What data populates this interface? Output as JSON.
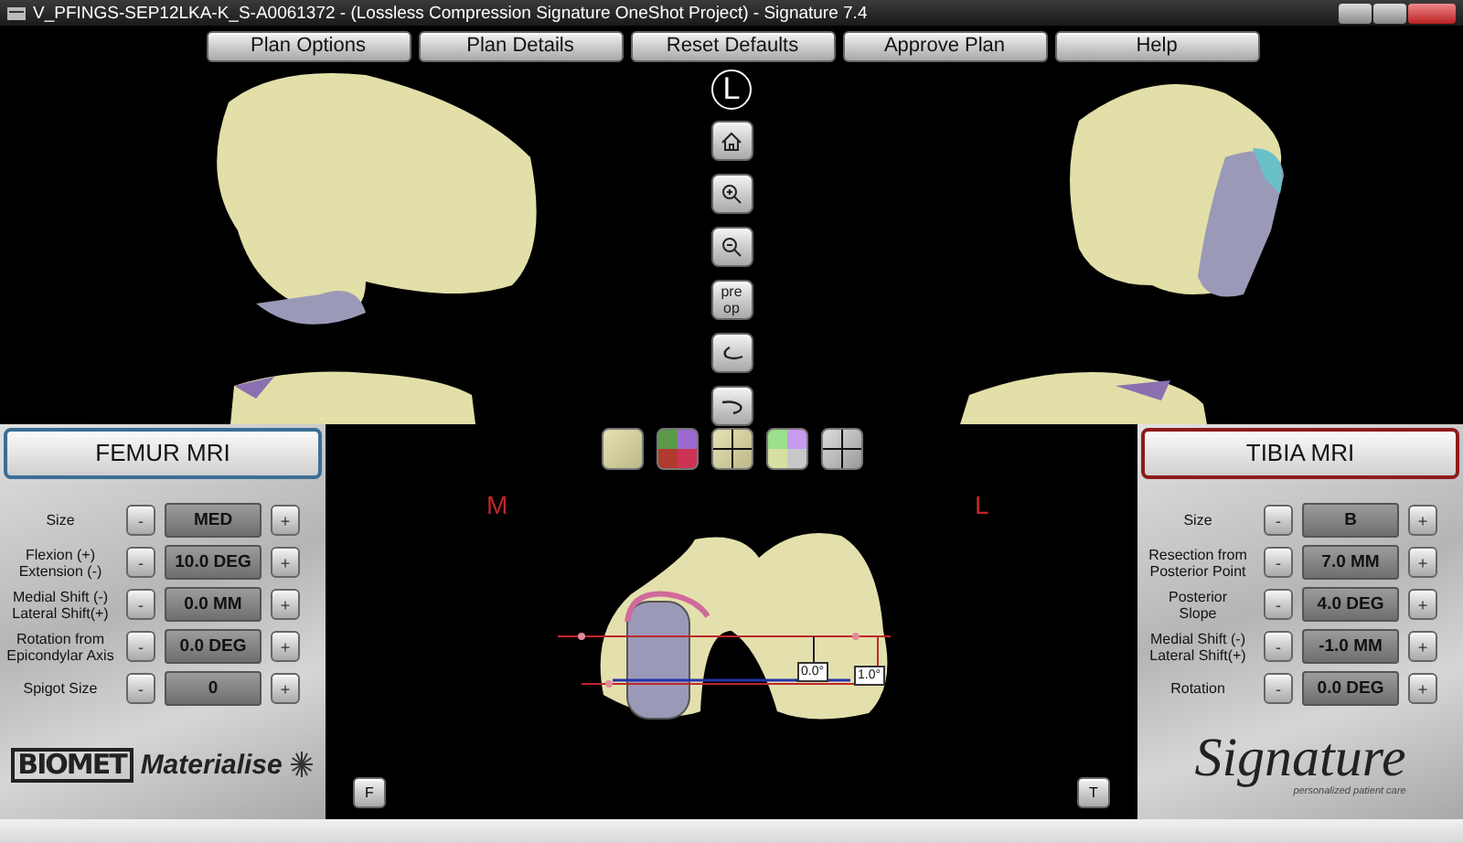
{
  "window": {
    "title": "V_PFINGS-SEP12LKA-K_S-A0061372 -  (Lossless Compression Signature OneShot Project) - Signature  7.4"
  },
  "toolbar": [
    "Plan Options",
    "Plan Details",
    "Reset Defaults",
    "Approve Plan",
    "Help"
  ],
  "view_tools": {
    "side_badge": "L",
    "buttons": [
      {
        "kind": "home"
      },
      {
        "kind": "zoom_in"
      },
      {
        "kind": "zoom_out"
      },
      {
        "kind": "text",
        "label": "pre op"
      },
      {
        "kind": "rotate_left"
      },
      {
        "kind": "rotate_right"
      }
    ]
  },
  "display_modes": [
    {
      "kind": "plain"
    },
    {
      "kind": "colormap"
    },
    {
      "kind": "crosshair"
    },
    {
      "kind": "colormap_light"
    },
    {
      "kind": "crosshair_gray"
    }
  ],
  "panels": [
    {
      "title": "FEMUR MRI",
      "color": "#3b6e96",
      "brand": {
        "kind": "biomet_materialise",
        "marks": [
          "BIOMET",
          "Materialise"
        ]
      },
      "rows": [
        {
          "label": "Size",
          "decrease": "-",
          "value": "MED",
          "increase": "+"
        },
        {
          "label": "Flexion (+)\nExtension (-)",
          "decrease": "-",
          "value": "10.0 DEG",
          "increase": "+"
        },
        {
          "label": "Medial Shift (-)\nLateral Shift(+)",
          "decrease": "-",
          "value": "0.0 MM",
          "increase": "+"
        },
        {
          "label": "Rotation from\nEpicondylar Axis",
          "decrease": "-",
          "value": "0.0 DEG",
          "increase": "+"
        },
        {
          "label": "Spigot Size",
          "decrease": "-",
          "value": "0",
          "increase": "+"
        }
      ]
    },
    {
      "title": "TIBIA MRI",
      "color": "#8e1b1b",
      "brand": {
        "kind": "signature",
        "marks": [
          "Signature",
          "personalized patient care"
        ]
      },
      "rows": [
        {
          "label": "Size",
          "decrease": "-",
          "value": "B",
          "increase": "+"
        },
        {
          "label": "Resection from\nPosterior Point",
          "decrease": "-",
          "value": "7.0 MM",
          "increase": "+"
        },
        {
          "label": "Posterior\nSlope",
          "decrease": "-",
          "value": "4.0 DEG",
          "increase": "+"
        },
        {
          "label": "Medial Shift (-)\nLateral Shift(+)",
          "decrease": "-",
          "value": "-1.0 MM",
          "increase": "+"
        },
        {
          "label": "Rotation",
          "decrease": "-",
          "value": "0.0 DEG",
          "increase": "+"
        }
      ]
    }
  ],
  "canvas": {
    "side_labels": [
      "M",
      "L"
    ],
    "measurements": [
      "0.0°",
      "1.0°"
    ],
    "corner_buttons": [
      "F",
      "T"
    ]
  }
}
